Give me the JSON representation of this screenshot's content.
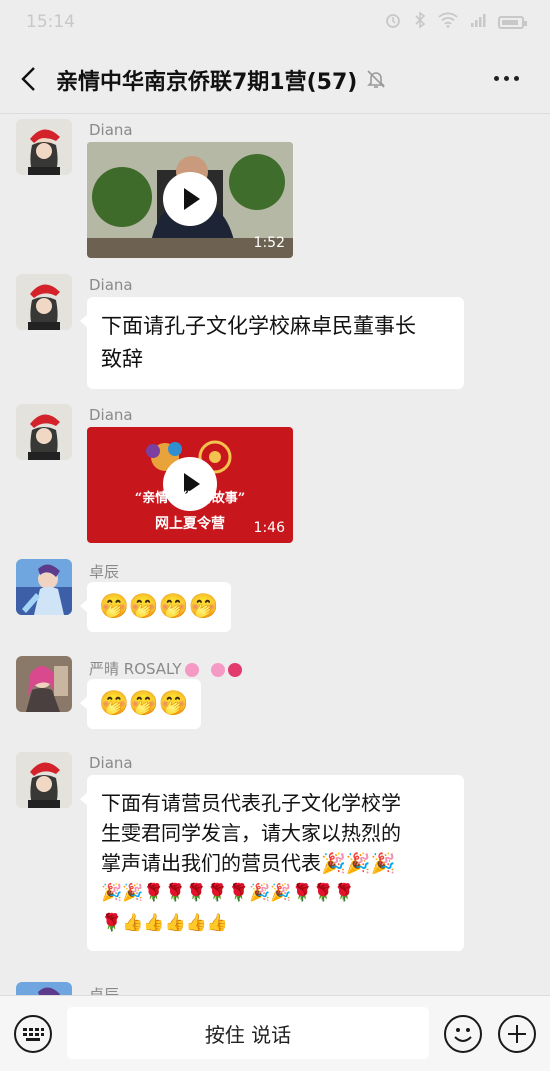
{
  "status_bar": {
    "time": "15:14"
  },
  "header": {
    "title": "亲情中华南京侨联7期1营(57)"
  },
  "messages": [
    {
      "sender": "Diana",
      "type": "video",
      "duration": "1:52"
    },
    {
      "sender": "Diana",
      "type": "text",
      "lines": [
        "下面请孔子文化学校麻卓民董事长",
        "致辞"
      ]
    },
    {
      "sender": "Diana",
      "type": "video",
      "duration": "1:46",
      "banner_line1": "“亲情中华 讲故事”",
      "banner_line2": "网上夏令营"
    },
    {
      "sender": "卓辰",
      "type": "emoji",
      "emoji": [
        "🤭",
        "🤭",
        "🤭",
        "🤭"
      ]
    },
    {
      "sender": "严晴 ROSALY",
      "type": "emoji",
      "emoji": [
        "🤭",
        "🤭",
        "🤭"
      ]
    },
    {
      "sender": "Diana",
      "type": "text",
      "lines": [
        "下面有请营员代表孔子文化学校学",
        "生雯君同学发言，请大家以热烈的",
        "掌声请出我们的营员代表🎉🎉🎉",
        "🎉🎉🌹🌹🌹🌹🌹🎉🎉🌹🌹🌹",
        "🌹👍👍👍👍👍"
      ]
    },
    {
      "sender": "卓辰"
    }
  ],
  "input_bar": {
    "hold_to_talk": "按住 说话"
  },
  "colors": {
    "background": "#ededed",
    "bubble": "#ffffff",
    "input_bar": "#f6f6f6"
  }
}
